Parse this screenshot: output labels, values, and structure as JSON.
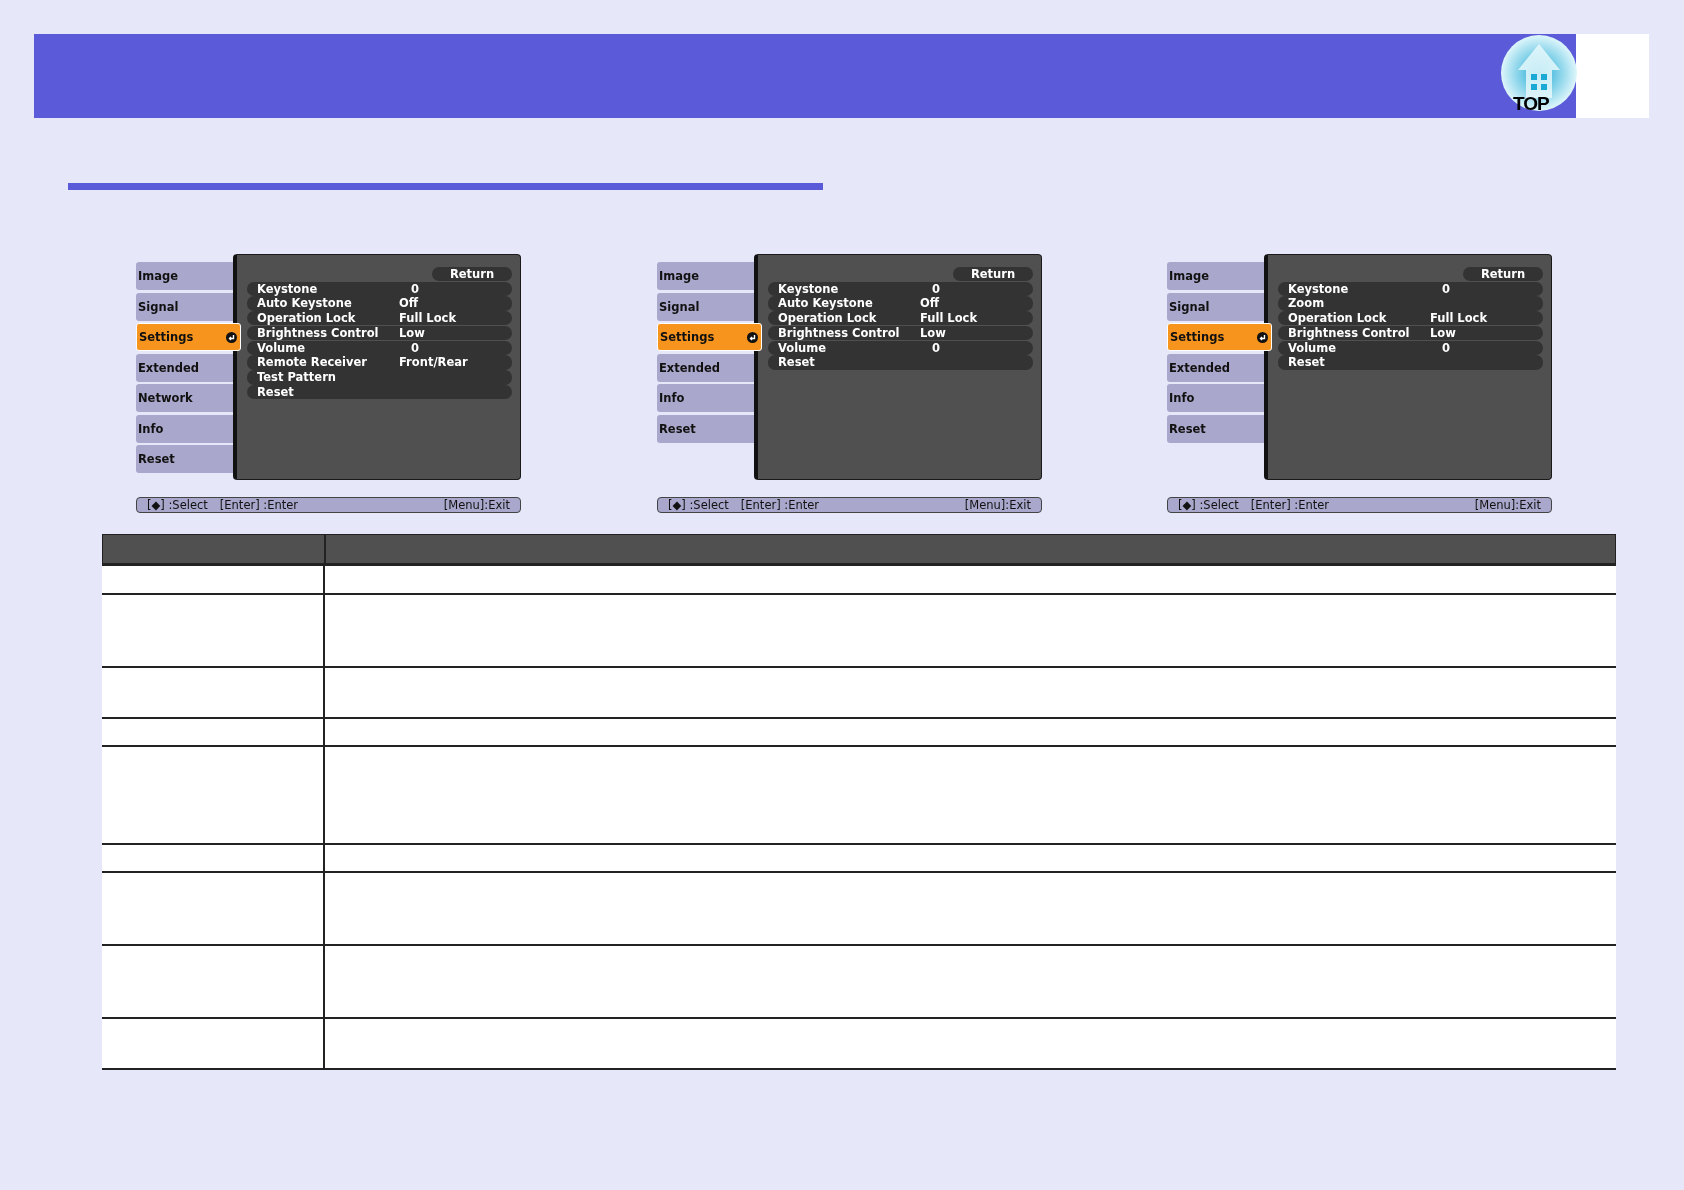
{
  "header": {
    "top_button": {
      "label": "TOP"
    }
  },
  "menus": [
    {
      "tabs": [
        {
          "label": "Image",
          "selected": false
        },
        {
          "label": "Signal",
          "selected": false
        },
        {
          "label": "Settings",
          "selected": true
        },
        {
          "label": "Extended",
          "selected": false
        },
        {
          "label": "Network",
          "selected": false
        },
        {
          "label": "Info",
          "selected": false
        },
        {
          "label": "Reset",
          "selected": false
        }
      ],
      "return_label": "Return",
      "items": [
        {
          "label": "Keystone",
          "value": "0"
        },
        {
          "label": "Auto Keystone",
          "value": "Off"
        },
        {
          "label": "Operation Lock",
          "value": "Full Lock"
        },
        {
          "label": "Brightness Control",
          "value": "Low"
        },
        {
          "label": "Volume",
          "value": "0"
        },
        {
          "label": "Remote Receiver",
          "value": "Front/Rear"
        },
        {
          "label": "Test Pattern"
        },
        {
          "label": "Reset"
        }
      ],
      "footer": {
        "select": "[◆] :Select",
        "enter": "[Enter] :Enter",
        "exit": "[Menu]:Exit"
      }
    },
    {
      "tabs": [
        {
          "label": "Image",
          "selected": false
        },
        {
          "label": "Signal",
          "selected": false
        },
        {
          "label": "Settings",
          "selected": true
        },
        {
          "label": "Extended",
          "selected": false
        },
        {
          "label": "Info",
          "selected": false
        },
        {
          "label": "Reset",
          "selected": false
        }
      ],
      "return_label": "Return",
      "items": [
        {
          "label": "Keystone",
          "value": "0"
        },
        {
          "label": "Auto Keystone",
          "value": "Off"
        },
        {
          "label": "Operation Lock",
          "value": "Full Lock"
        },
        {
          "label": "Brightness Control",
          "value": "Low"
        },
        {
          "label": "Volume",
          "value": "0"
        },
        {
          "label": "Reset"
        }
      ],
      "footer": {
        "select": "[◆] :Select",
        "enter": "[Enter] :Enter",
        "exit": "[Menu]:Exit"
      }
    },
    {
      "tabs": [
        {
          "label": "Image",
          "selected": false
        },
        {
          "label": "Signal",
          "selected": false
        },
        {
          "label": "Settings",
          "selected": true
        },
        {
          "label": "Extended",
          "selected": false
        },
        {
          "label": "Info",
          "selected": false
        },
        {
          "label": "Reset",
          "selected": false
        }
      ],
      "return_label": "Return",
      "items": [
        {
          "label": "Keystone",
          "value": "0"
        },
        {
          "label": "Zoom"
        },
        {
          "label": "Operation Lock",
          "value": "Full Lock"
        },
        {
          "label": "Brightness Control",
          "value": "Low"
        },
        {
          "label": "Volume",
          "value": "0"
        },
        {
          "label": "Reset"
        }
      ],
      "footer": {
        "select": "[◆] :Select",
        "enter": "[Enter] :Enter",
        "exit": "[Menu]:Exit"
      }
    }
  ]
}
